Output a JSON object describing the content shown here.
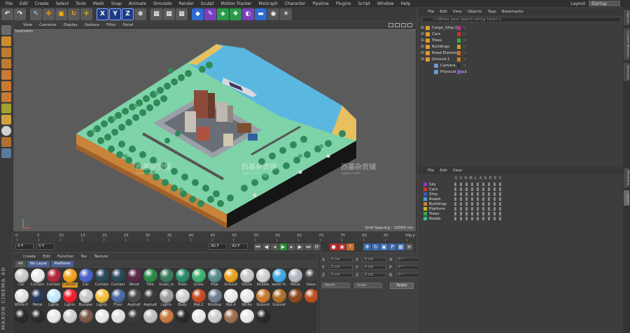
{
  "menubar": {
    "items": [
      "File",
      "Edit",
      "Create",
      "Select",
      "Tools",
      "Mesh",
      "Snap",
      "Animate",
      "Simulate",
      "Render",
      "Sculpt",
      "Motion Tracker",
      "MoGraph",
      "Character",
      "Pipeline",
      "Plugins",
      "Script",
      "Window",
      "Help"
    ],
    "layout_label": "Layout:",
    "layout_value": "Startup"
  },
  "toolbar": {
    "x_label": "X",
    "y_label": "Y",
    "z_label": "Z"
  },
  "viewport": {
    "menu": [
      "View",
      "Cameras",
      "Display",
      "Options",
      "Filter",
      "Panel"
    ],
    "label": "Isometric",
    "grid_spacing": "Grid Spacing : 10000 cm"
  },
  "timeline": {
    "ticks": [
      "0",
      "5",
      "10",
      "15",
      "20",
      "25",
      "30",
      "35",
      "40",
      "45",
      "50",
      "55",
      "60",
      "65",
      "70",
      "75",
      "80",
      "85",
      "90"
    ],
    "end_frame": "0 F"
  },
  "playback": {
    "start_field": "0 F",
    "current_field": "0 F",
    "end_field": "90 F",
    "end_field2": "90 F"
  },
  "material_manager": {
    "menu": [
      "Create",
      "Edit",
      "Function",
      "Tex",
      "Texture"
    ],
    "filters": [
      "All",
      "No Layer",
      "Platform"
    ],
    "materials": [
      {
        "name": "Car",
        "color": "#c8c8c8"
      },
      {
        "name": "Contain",
        "color": "#e8e8e8"
      },
      {
        "name": "Contain",
        "color": "#b0283c"
      },
      {
        "name": "Contain",
        "color": "#f0a020",
        "selected": true
      },
      {
        "name": "Car",
        "color": "#4a64c8"
      },
      {
        "name": "Contain",
        "color": "#2a4a5a"
      },
      {
        "name": "Contain",
        "color": "#2a4a5a"
      },
      {
        "name": "Wood",
        "color": "#5a2a4a"
      },
      {
        "name": "Tree",
        "color": "#2a8a4a"
      },
      {
        "name": "Grass_si",
        "color": "#3a7a5a"
      },
      {
        "name": "Trees",
        "color": "#2a8a6a"
      },
      {
        "name": "Grass",
        "color": "#40b070"
      },
      {
        "name": "Pipe",
        "color": "#5a8a8a"
      },
      {
        "name": "Ground",
        "color": "#e8a020"
      },
      {
        "name": "Stone",
        "color": "#c8c8c8"
      },
      {
        "name": "Streets",
        "color": "#d0d0d0"
      },
      {
        "name": "water fc",
        "color": "#40a8e0"
      },
      {
        "name": "Metal",
        "color": "#b0b8c0"
      },
      {
        "name": "Glass",
        "color": "#404040"
      },
      {
        "name": "White P",
        "color": "#e0e0e0"
      },
      {
        "name": "Metal",
        "color": "#2a3a5a"
      },
      {
        "name": "Lights",
        "color": "#c0e8f8"
      },
      {
        "name": "Lights",
        "color": "#f02030"
      },
      {
        "name": "Bumper",
        "color": "#c8c8c8"
      },
      {
        "name": "Lights",
        "color": "#f0c040"
      },
      {
        "name": "Floor",
        "color": "#4a6aa0"
      },
      {
        "name": "Asphalt",
        "color": "#4a4a4a"
      },
      {
        "name": "Asphalt",
        "color": "#3a3a3a"
      },
      {
        "name": "Lights",
        "color": "#a0a0a0"
      },
      {
        "name": "Body",
        "color": "#d0d0d0"
      },
      {
        "name": "Mat.2",
        "color": "#c84a20"
      },
      {
        "name": "Window",
        "color": "#708090"
      },
      {
        "name": "Mat.4",
        "color": "#e8e8e8"
      },
      {
        "name": "White",
        "color": "#e8e8e8"
      },
      {
        "name": "Ground",
        "color": "#c87a30"
      },
      {
        "name": "Ground",
        "color": "#b0702a"
      },
      {
        "name": "",
        "color": "#8a4a20"
      },
      {
        "name": "",
        "color": "#c05020"
      },
      {
        "name": "",
        "color": "#2a2a2a"
      },
      {
        "name": "",
        "color": "#2a2a2a"
      },
      {
        "name": "",
        "color": "#e8e8e8"
      },
      {
        "name": "",
        "color": "#d0d0d0"
      },
      {
        "name": "",
        "color": "#7a5a4a"
      },
      {
        "name": "",
        "color": "#e8e8e8"
      },
      {
        "name": "",
        "color": "#e0e0e0"
      },
      {
        "name": "",
        "color": "#3a3a3a"
      },
      {
        "name": "",
        "color": "#c0c0c0"
      },
      {
        "name": "",
        "color": "#c87a40"
      },
      {
        "name": "",
        "color": "#2a2a2a"
      },
      {
        "name": "",
        "color": "#e8e8e8"
      },
      {
        "name": "",
        "color": "#d0d0d0"
      },
      {
        "name": "",
        "color": "#a07050"
      },
      {
        "name": "",
        "color": "#e8e8e8"
      },
      {
        "name": "",
        "color": "#2a2a2a"
      }
    ]
  },
  "attributes": {
    "rows": [
      {
        "a": "X",
        "v1": "0 cm",
        "b": "X",
        "v2": "0 cm",
        "c": "H",
        "v3": "0 °"
      },
      {
        "a": "Y",
        "v1": "0 cm",
        "b": "Y",
        "v2": "0 cm",
        "c": "P",
        "v3": "0 °"
      },
      {
        "a": "Z",
        "v1": "0 cm",
        "b": "Z",
        "v2": "0 cm",
        "c": "B",
        "v3": "0 °"
      }
    ],
    "dropdown1": "World",
    "dropdown2": "Scale",
    "apply_label": "Apply"
  },
  "object_manager": {
    "menu": [
      "File",
      "Edit",
      "View",
      "Objects",
      "Tags",
      "Bookmarks"
    ],
    "search_placeholder": "<<Enter your search string here>>",
    "objects": [
      {
        "name": "Cargo_Ship.1",
        "icon_color": "#e09a30",
        "swatch": "#c03090"
      },
      {
        "name": "Cars",
        "icon_color": "#e09a30",
        "swatch": "#d03030"
      },
      {
        "name": "Trees",
        "icon_color": "#e09a30",
        "swatch": "#30b040"
      },
      {
        "name": "Buildings",
        "icon_color": "#e09a30",
        "swatch": "#d0a020"
      },
      {
        "name": "Road Elements",
        "icon_color": "#e09a30",
        "swatch": "#d07020"
      },
      {
        "name": "Ground.1",
        "icon_color": "#e09a30",
        "swatch": "#d08020"
      },
      {
        "name": "Camera.3",
        "icon_color": "#6a9ad0",
        "swatch": "#303030"
      },
      {
        "name": "Physical Sky.1",
        "icon_color": "#6a9ad0",
        "swatch": "#8a4ad0"
      }
    ]
  },
  "layer_manager": {
    "menu": [
      "File",
      "Edit",
      "View"
    ],
    "header": [
      "S",
      "V",
      "R",
      "M",
      "L",
      "A",
      "G",
      "D",
      "E",
      "X"
    ],
    "layers": [
      {
        "name": "Sky",
        "color": "#8a40c0"
      },
      {
        "name": "Cars",
        "color": "#d03030"
      },
      {
        "name": "Ship",
        "color": "#3060c0"
      },
      {
        "name": "Roads",
        "color": "#40a0d0"
      },
      {
        "name": "Buildings",
        "color": "#d08030"
      },
      {
        "name": "Platform",
        "color": "#d0b020"
      },
      {
        "name": "Trees",
        "color": "#30b040"
      },
      {
        "name": "Roads",
        "color": "#30c0a0"
      }
    ]
  },
  "side_tabs": [
    "Objects",
    "Content Browser",
    "Structure",
    "Attributes",
    "Layers"
  ],
  "watermarks": [
    {
      "text": "西基杂货铺",
      "sub": "cggou.com"
    },
    {
      "text": "西基杂货铺",
      "sub": "cggou.com"
    },
    {
      "text": "西基杂货铺",
      "sub": "cggou.com"
    }
  ],
  "brand": "MAXON CINEMA 4D"
}
